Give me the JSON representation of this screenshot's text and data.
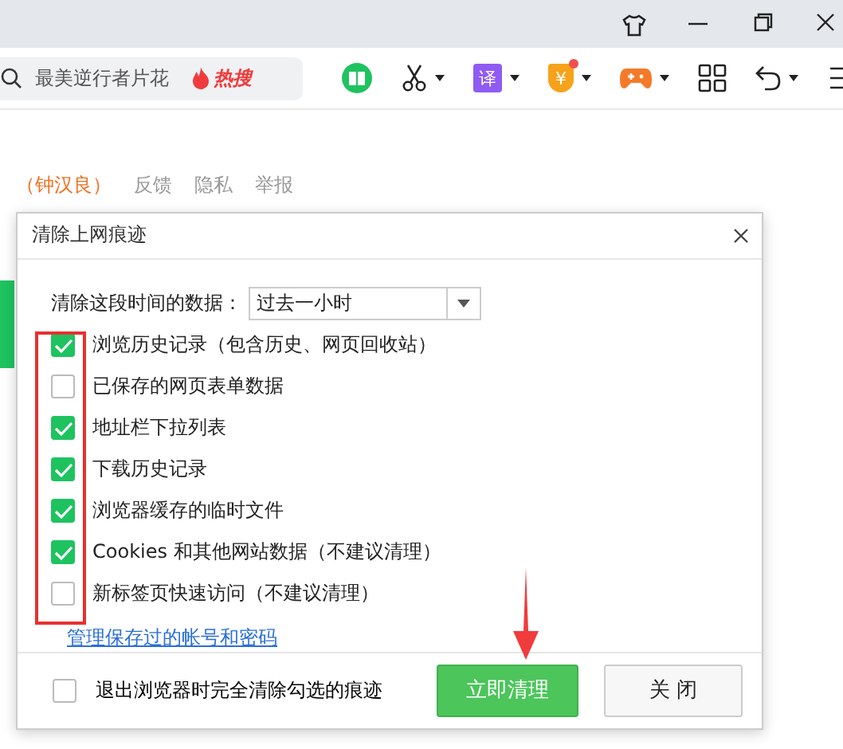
{
  "toolbar": {
    "search": {
      "value": "最美逆行者片花",
      "hot_label": "热搜"
    },
    "translate_glyph": "译",
    "coupon_glyph": "¥",
    "coupon_badge": true
  },
  "page_links": [
    {
      "label": "（钟汉良）",
      "kind": "news"
    },
    {
      "label": "反馈",
      "kind": "plain"
    },
    {
      "label": "隐私",
      "kind": "plain"
    },
    {
      "label": "举报",
      "kind": "plain"
    }
  ],
  "dialog": {
    "title": "清除上网痕迹",
    "time_label": "清除这段时间的数据：",
    "time_value": "过去一小时",
    "options": [
      {
        "label": "浏览历史记录（包含历史、网页回收站）",
        "checked": true
      },
      {
        "label": "已保存的网页表单数据",
        "checked": false
      },
      {
        "label": "地址栏下拉列表",
        "checked": true
      },
      {
        "label": "下载历史记录",
        "checked": true
      },
      {
        "label": "浏览器缓存的临时文件",
        "checked": true
      },
      {
        "label": "Cookies 和其他网站数据（不建议清理）",
        "checked": true
      },
      {
        "label": "新标签页快速访问（不建议清理）",
        "checked": false
      }
    ],
    "manage_link": "管理保存过的帐号和密码",
    "exit_option": {
      "label": "退出浏览器时完全清除勾选的痕迹",
      "checked": false
    },
    "buttons": [
      {
        "label": "立即清理",
        "kind": "primary"
      },
      {
        "label": "关 闭",
        "kind": "secondary"
      }
    ]
  }
}
